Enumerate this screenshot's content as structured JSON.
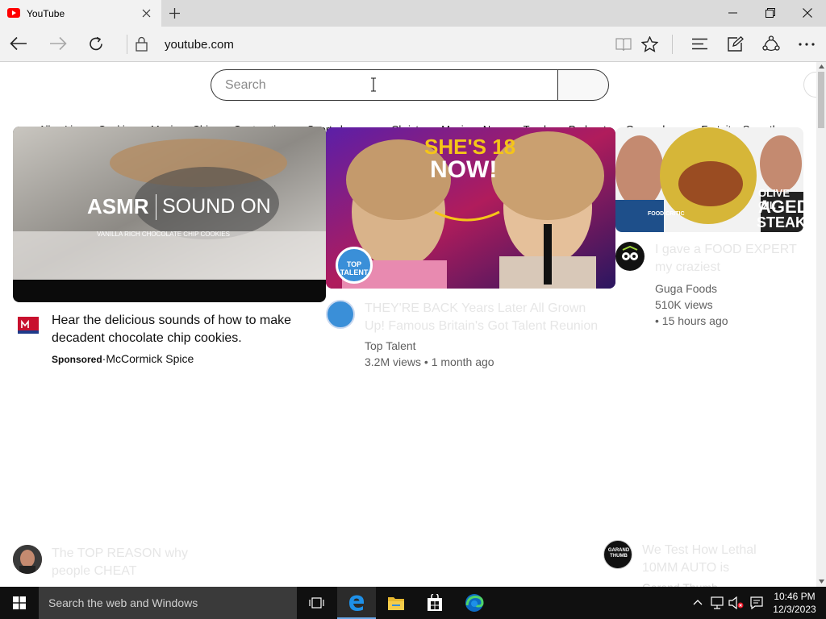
{
  "browser": {
    "tab_title": "YouTube",
    "url": "youtube.com"
  },
  "youtube": {
    "search_placeholder": "Search",
    "chips": [
      "All",
      "Live",
      "Cooking",
      "Music",
      "Chips",
      "Contraptions",
      "Sports leagues",
      "Christmas Music",
      "News",
      "Trucks",
      "Podcasts",
      "Game shows",
      "Fortnite: Save the"
    ],
    "videos": [
      {
        "thumb_text_main": "ASMR",
        "thumb_text_sub": "SOUND ON",
        "thumb_text_small": "VANILLA RICH CHOCOLATE CHIP COOKIES",
        "title": "Hear the delicious sounds of how to make decadent chocolate chip cookies.",
        "sponsored": "Sponsored",
        "channel": "McCormick Spice"
      },
      {
        "thumb_text_main": "SHE'S 18",
        "thumb_text_sub": "NOW!",
        "thumb_badge": "TOP TALENT",
        "title": "THEY'RE BACK Years Later All Grown Up! Famous Britain's Got Talent Reunion",
        "channel": "Top Talent",
        "views": "3.2M views",
        "age": "1 month ago"
      },
      {
        "thumb_text_main": "OLIVE OIL",
        "thumb_text_sub": "AGED",
        "thumb_text_extra": "STEAK",
        "thumb_label": "FOOD CRITIC",
        "title": "I gave a FOOD EXPERT my craziest",
        "channel": "Guga Foods",
        "views": "510K views",
        "age": "15 hours ago"
      },
      {
        "title": "The TOP REASON why people CHEAT"
      },
      {
        "avatar_text": "GARAND THUMB",
        "title": "We Test How Lethal 10MM AUTO is",
        "channel": "Garand Thumb"
      }
    ]
  },
  "taskbar": {
    "search_placeholder": "Search the web and Windows",
    "time": "10:46 PM",
    "date": "12/3/2023"
  },
  "colors": {
    "youtube_red": "#ff0000",
    "taskbar_bg": "#101010",
    "edge_blue": "#0078d7"
  }
}
